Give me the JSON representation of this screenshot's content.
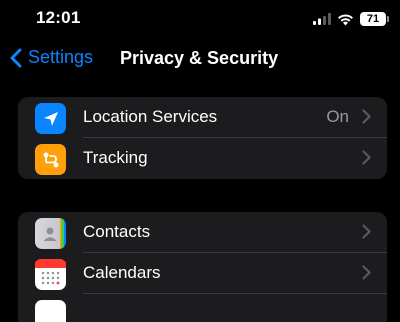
{
  "status_bar": {
    "time": "12:01",
    "battery_level": "71"
  },
  "nav": {
    "back_label": "Settings",
    "title": "Privacy & Security"
  },
  "groups": [
    {
      "rows": [
        {
          "label": "Location Services",
          "value": "On",
          "icon": "location-arrow-icon",
          "icon_color": "#0a84ff"
        },
        {
          "label": "Tracking",
          "icon": "tracking-icon",
          "icon_color": "#ff9f0a"
        }
      ]
    },
    {
      "rows": [
        {
          "label": "Contacts",
          "icon": "contacts-icon",
          "icon_color": "#c7c7cc"
        },
        {
          "label": "Calendars",
          "icon": "calendar-icon",
          "icon_color": "#ffffff"
        }
      ]
    }
  ],
  "colors": {
    "accent": "#0a84ff",
    "cell_background": "#1c1c1e",
    "page_background": "#000000"
  }
}
